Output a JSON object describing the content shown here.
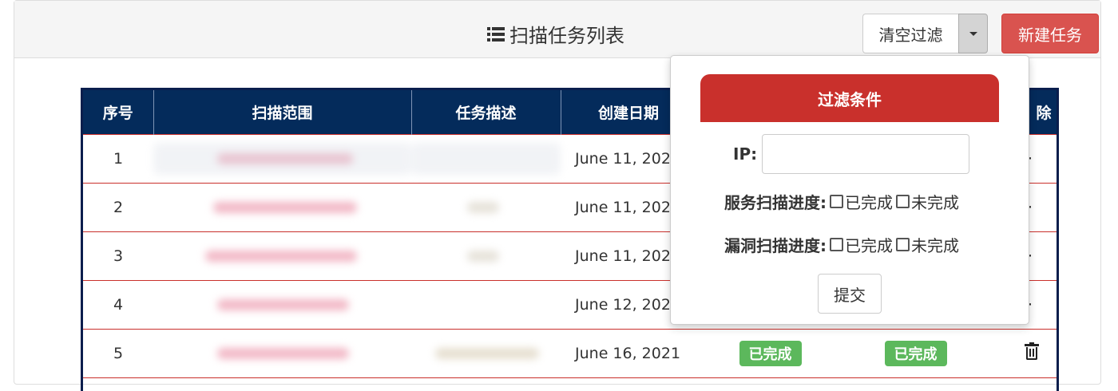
{
  "header": {
    "title": "扫描任务列表",
    "clear_filter_label": "清空过滤",
    "new_task_label": "新建任务"
  },
  "table": {
    "columns": [
      "序号",
      "扫描范围",
      "任务描述",
      "创建日期",
      "除"
    ],
    "rows": [
      {
        "index": "1",
        "date": "June 11, 202",
        "service_status": "",
        "vuln_status": "",
        "delete_char": "·"
      },
      {
        "index": "2",
        "date": "June 11, 202",
        "service_status": "",
        "vuln_status": "",
        "delete_char": "·"
      },
      {
        "index": "3",
        "date": "June 11, 202",
        "service_status": "",
        "vuln_status": "",
        "delete_char": "·"
      },
      {
        "index": "4",
        "date": "June 12, 202",
        "service_status": "",
        "vuln_status": "",
        "delete_char": "·"
      },
      {
        "index": "5",
        "date": "June 16, 2021",
        "service_status": "已完成",
        "vuln_status": "已完成",
        "delete_char": ""
      }
    ]
  },
  "filter_popover": {
    "title": "过滤条件",
    "ip_label": "IP:",
    "ip_value": "",
    "service_label": "服务扫描进度:",
    "vuln_label": "漏洞扫描进度:",
    "option_done": "已完成",
    "option_undone": "未完成",
    "submit_label": "提交"
  },
  "colors": {
    "table_header": "#042b5b",
    "danger": "#d9534f",
    "success": "#5cb85c",
    "row_border": "#c9302c"
  }
}
